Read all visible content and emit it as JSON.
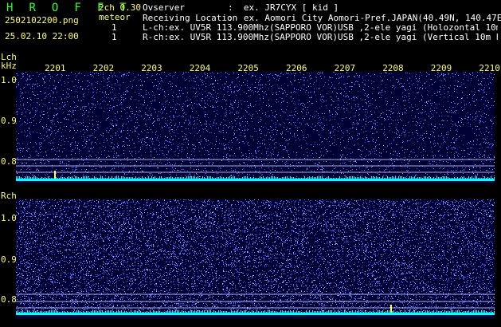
{
  "header": {
    "app_logo": "H R O F F T",
    "version": "2ch 0.30",
    "filename": "2502102200.png",
    "meteor_label": "meteor",
    "meteor_l": "1",
    "meteor_r": "1",
    "datetime": "25.02.10 22:00",
    "observer_label": "Ovserver",
    "observer_value": ":  ex. JR7CYX [ kid ]",
    "location_label": "Receiving Location",
    "location_value": ":  ex. Aomori City Aomori-Pref.JAPAN(40.49N, 140.47E)",
    "lch_info": "L-ch:ex. UV5R 113.900Mhz(SAPPORO VOR)USB ,2-ele yagi (Holozontal 10m height)",
    "rch_info": "R-ch:ex. UV5R 113.900Mhz(SAPPORO VOR)USB ,2-ele yagi (Vertical 10m height)"
  },
  "time_axis": {
    "ticks": [
      "2201",
      "2202",
      "2203",
      "2204",
      "2205",
      "2206",
      "2207",
      "2208",
      "2209",
      "2210"
    ]
  },
  "lch_panel": {
    "title": "Lch",
    "unit": "kHz",
    "ticks": [
      "1.0",
      "0.9",
      "0.8"
    ]
  },
  "rch_panel": {
    "title": "Rch",
    "ticks": [
      "1.0",
      "0.9",
      "0.8"
    ]
  },
  "colors": {
    "header_text": "#ffffff",
    "logo": "#33ff33",
    "accent_yellow": "#ffff66",
    "background_panel": "#000033",
    "noise": "#3366ff",
    "baseline": "#00ffff",
    "hline": "#aaaaee"
  }
}
